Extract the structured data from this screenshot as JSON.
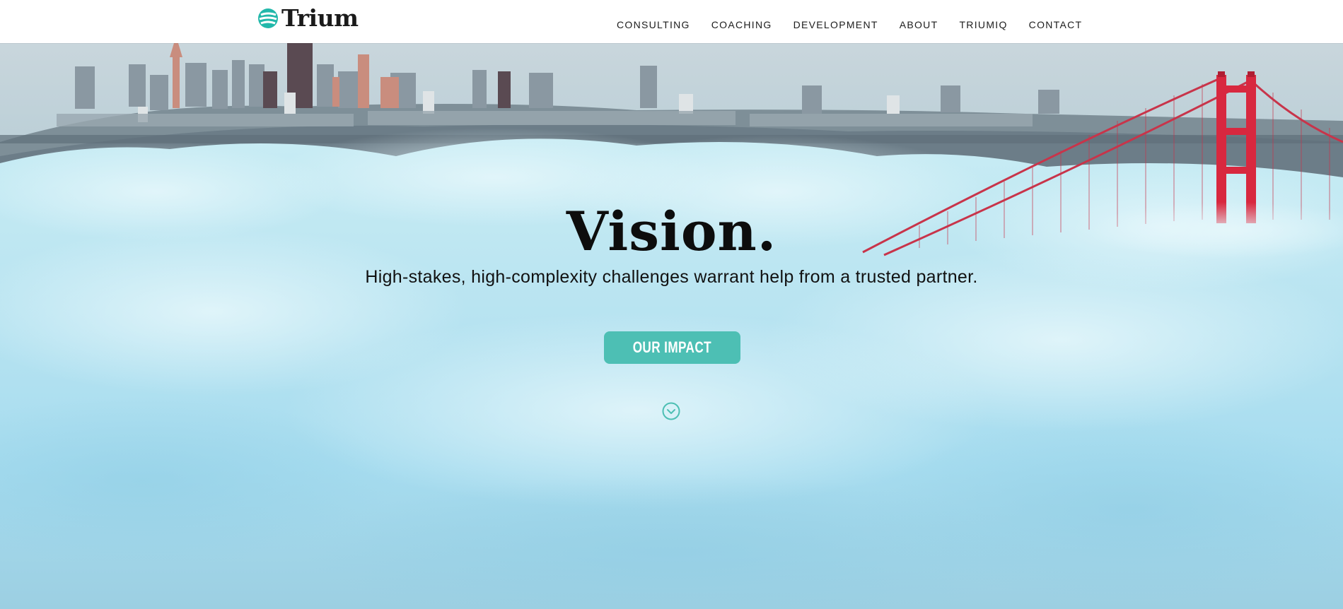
{
  "header": {
    "brand": "Trium",
    "nav": [
      {
        "label": "CONSULTING"
      },
      {
        "label": "COACHING"
      },
      {
        "label": "DEVELOPMENT"
      },
      {
        "label": "ABOUT"
      },
      {
        "label": "TRIUMIQ"
      },
      {
        "label": "CONTACT"
      }
    ]
  },
  "hero": {
    "title": "Vision.",
    "subtitle": "High-stakes, high-complexity challenges warrant help from a trusted partner.",
    "cta_label": "OUR IMPACT",
    "scroll_icon": "chevron-down-circle-icon",
    "background": "city skyline and red suspension bridge above fog"
  },
  "colors": {
    "accent": "#4dbfb4",
    "bridge": "#d8283f",
    "header_bg": "#ffffff",
    "text": "#111111"
  }
}
